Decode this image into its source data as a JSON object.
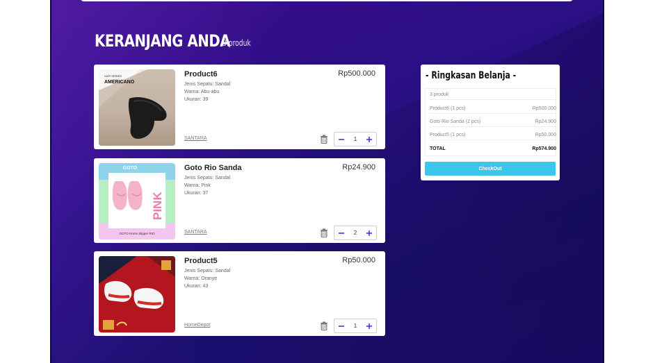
{
  "cart": {
    "title": "KERANJANG ANDA",
    "count_label": "3 produk",
    "items": [
      {
        "name": "Product6",
        "price": "Rp500.000",
        "type": "Jenis Sepatu: Sandal",
        "color": "Warna: Abu-abu",
        "size": "Ukuran: 39",
        "store": "SANTARA",
        "qty": "1",
        "thumb_text": "AMERICANO",
        "thumb_subtext": "KAPI SERIES"
      },
      {
        "name": "Goto Rio Sanda",
        "price": "Rp24.900",
        "type": "Jenis Sepatu: Sandal",
        "color": "Warna: Pink",
        "size": "Ukuran: 37",
        "store": "SANTARA",
        "qty": "2",
        "thumb_brand": "GOTO",
        "thumb_word": "PINK",
        "thumb_caption": "GOTO Home Slipper RIO"
      },
      {
        "name": "Product5",
        "price": "Rp50.000",
        "type": "Jenis Sepatu: Sandal",
        "color": "Warna: Oranye",
        "size": "Ukuran: 43",
        "store": "HomeDepot",
        "qty": "1"
      }
    ]
  },
  "summary": {
    "title": "- Ringkasan Belanja -",
    "rows": [
      {
        "label": "3 produk",
        "value": ""
      },
      {
        "label": "Product6 (1 pcs)",
        "value": "Rp500.000"
      },
      {
        "label": "Goto Rio Sanda (2 pcs)",
        "value": "Rp24.900"
      },
      {
        "label": "Product5 (1 pcs)",
        "value": "Rp50.000"
      }
    ],
    "total_label": "TOTAL",
    "total_value": "Rp574.900",
    "checkout_label": "CheckOut"
  },
  "colors": {
    "accent_purple": "#5b2bd6",
    "checkout": "#3ac7ec",
    "background": "#2a0f85"
  },
  "icons": {
    "delete": "trash-icon",
    "decrease": "minus-icon",
    "increase": "plus-icon"
  }
}
